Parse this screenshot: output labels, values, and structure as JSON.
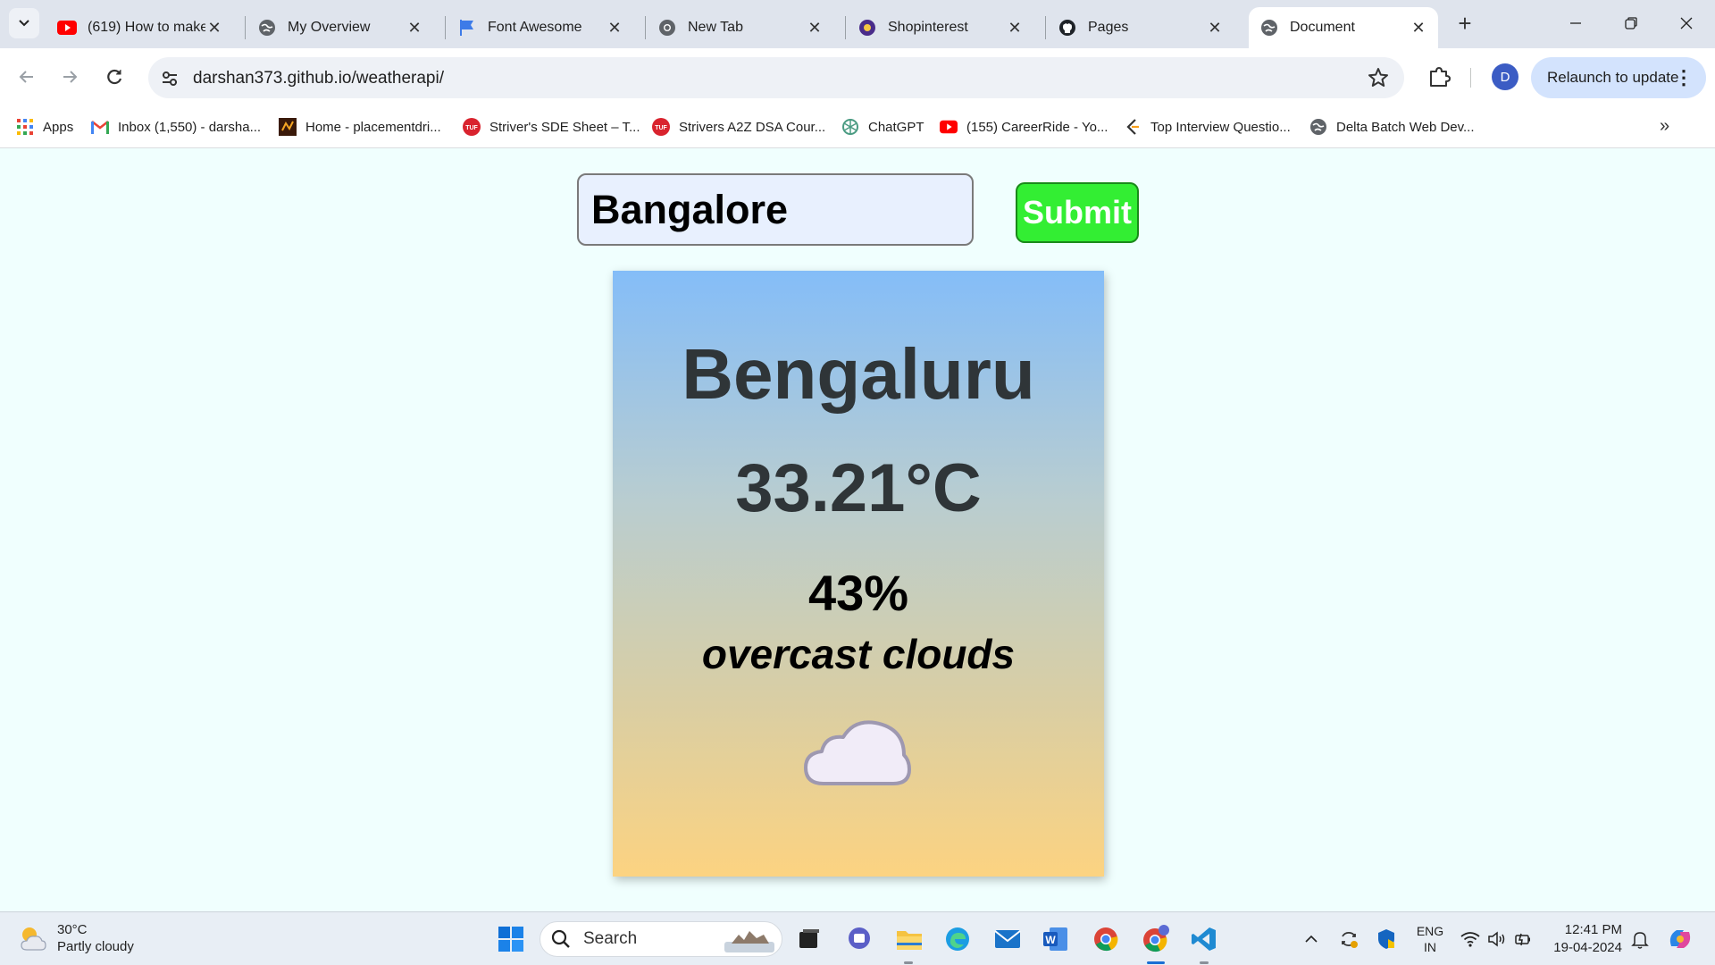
{
  "browser": {
    "tabs": [
      {
        "title": "(619) How to make",
        "icon": "youtube-icon"
      },
      {
        "title": "My Overview",
        "icon": "globe-icon"
      },
      {
        "title": "Font Awesome",
        "icon": "flag-icon"
      },
      {
        "title": "New Tab",
        "icon": "chrome-icon"
      },
      {
        "title": "Shopinterest",
        "icon": "shopinterest-icon"
      },
      {
        "title": "Pages",
        "icon": "github-icon"
      },
      {
        "title": "Document",
        "icon": "globe-icon",
        "active": true
      }
    ],
    "url": "darshan373.github.io/weatherapi/",
    "profile_initial": "D",
    "relaunch_label": "Relaunch to update",
    "bookmarks": [
      {
        "label": "Apps",
        "icon": "apps-grid-icon"
      },
      {
        "label": "Inbox (1,550) - darsha...",
        "icon": "gmail-icon"
      },
      {
        "label": "Home - placementdri...",
        "icon": "placement-icon"
      },
      {
        "label": "Striver's SDE Sheet – T...",
        "icon": "tuf-icon"
      },
      {
        "label": "Strivers A2Z DSA Cour...",
        "icon": "tuf-icon"
      },
      {
        "label": "ChatGPT",
        "icon": "chatgpt-icon"
      },
      {
        "label": "(155) CareerRide - Yo...",
        "icon": "youtube-icon"
      },
      {
        "label": "Top Interview Questio...",
        "icon": "leetcode-icon"
      },
      {
        "label": "Delta Batch Web Dev...",
        "icon": "globe-icon"
      }
    ]
  },
  "app": {
    "input_value": "Bangalore",
    "submit_label": "Submit",
    "city": "Bengaluru",
    "temperature": "33.21°C",
    "humidity": "43%",
    "description": "overcast clouds",
    "weather_icon": "cloud-icon",
    "colors": {
      "submit_bg": "#33ee33",
      "card_top": "#84bdf8",
      "card_bottom": "#fcd381"
    }
  },
  "taskbar": {
    "weather_temp": "30°C",
    "weather_desc": "Partly cloudy",
    "search_placeholder": "Search",
    "lang_top": "ENG",
    "lang_bottom": "IN",
    "time": "12:41 PM",
    "date": "19-04-2024"
  }
}
